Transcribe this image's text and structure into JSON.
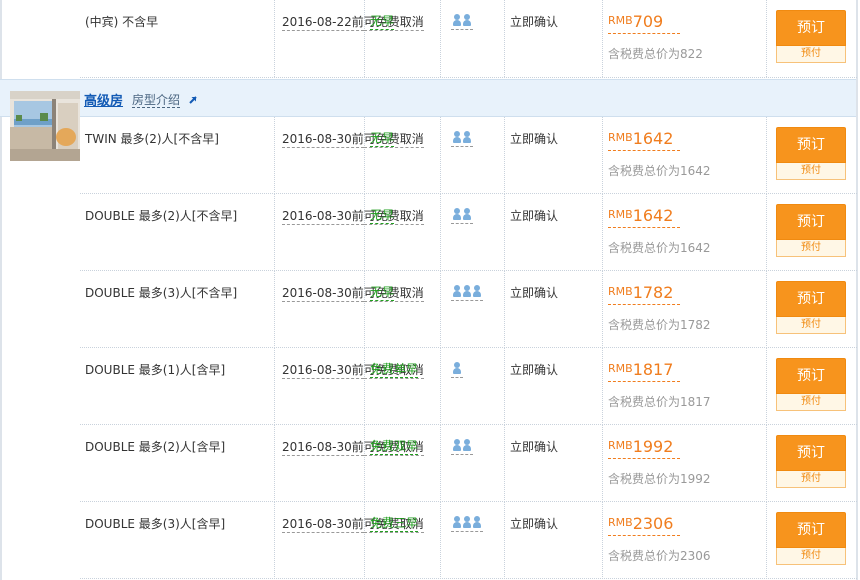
{
  "group": {
    "title": "高级房",
    "intro_label": "房型介绍"
  },
  "rows": [
    {
      "room": "(中宾) 不含早",
      "date": "2016-08-22前",
      "cancel": "可免费取消",
      "breakfast": "无早",
      "guests": 2,
      "confirm": "立即确认",
      "currency": "RMB",
      "price": "709",
      "total": "含税费总价为822",
      "book": "预订",
      "book_sub": "预付"
    },
    {
      "room": "TWIN 最多(2)人[不含早]",
      "date": "2016-08-30前",
      "cancel": "可免费取消",
      "breakfast": "无早",
      "guests": 2,
      "confirm": "立即确认",
      "currency": "RMB",
      "price": "1642",
      "total": "含税费总价为1642",
      "book": "预订",
      "book_sub": "预付"
    },
    {
      "room": "DOUBLE 最多(2)人[不含早]",
      "date": "2016-08-30前",
      "cancel": "可免费取消",
      "breakfast": "无早",
      "guests": 2,
      "confirm": "立即确认",
      "currency": "RMB",
      "price": "1642",
      "total": "含税费总价为1642",
      "book": "预订",
      "book_sub": "预付"
    },
    {
      "room": "DOUBLE 最多(3)人[不含早]",
      "date": "2016-08-30前",
      "cancel": "可免费取消",
      "breakfast": "无早",
      "guests": 3,
      "confirm": "立即确认",
      "currency": "RMB",
      "price": "1782",
      "total": "含税费总价为1782",
      "book": "预订",
      "book_sub": "预付"
    },
    {
      "room": "DOUBLE 最多(1)人[含早]",
      "date": "2016-08-30前",
      "cancel": "可免费取消",
      "breakfast": "免费单早",
      "guests": 1,
      "confirm": "立即确认",
      "currency": "RMB",
      "price": "1817",
      "total": "含税费总价为1817",
      "book": "预订",
      "book_sub": "预付"
    },
    {
      "room": "DOUBLE 最多(2)人[含早]",
      "date": "2016-08-30前",
      "cancel": "可免费取消",
      "breakfast": "免费双早",
      "guests": 2,
      "confirm": "立即确认",
      "currency": "RMB",
      "price": "1992",
      "total": "含税费总价为1992",
      "book": "预订",
      "book_sub": "预付"
    },
    {
      "room": "DOUBLE 最多(3)人[含早]",
      "date": "2016-08-30前",
      "cancel": "可免费取消",
      "breakfast": "免费三早",
      "guests": 3,
      "confirm": "立即确认",
      "currency": "RMB",
      "price": "2306",
      "total": "含税费总价为2306",
      "book": "预订",
      "book_sub": "预付"
    }
  ],
  "colors": {
    "accent_orange": "#f7941d",
    "price_orange": "#f07d1e",
    "breakfast_green": "#22a020",
    "link_blue": "#135bb5",
    "header_bg": "#e8f2fb"
  }
}
